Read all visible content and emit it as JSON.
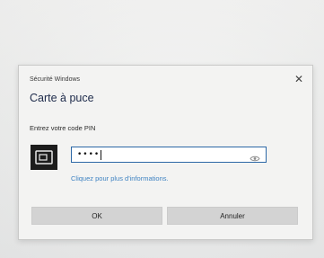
{
  "dialog": {
    "window_title": "Sécurité Windows",
    "heading": "Carte à puce",
    "prompt": "Entrez votre code PIN",
    "pin_value": "••••",
    "more_info_link": "Cliquez pour plus d'informations.",
    "ok_label": "OK",
    "cancel_label": "Annuler",
    "icons": {
      "close": "close-icon",
      "card": "smart-card-icon",
      "reveal": "eye-icon"
    },
    "colors": {
      "accent": "#2b67a6",
      "link": "#3f83c2",
      "heading": "#1d2a4a"
    }
  }
}
